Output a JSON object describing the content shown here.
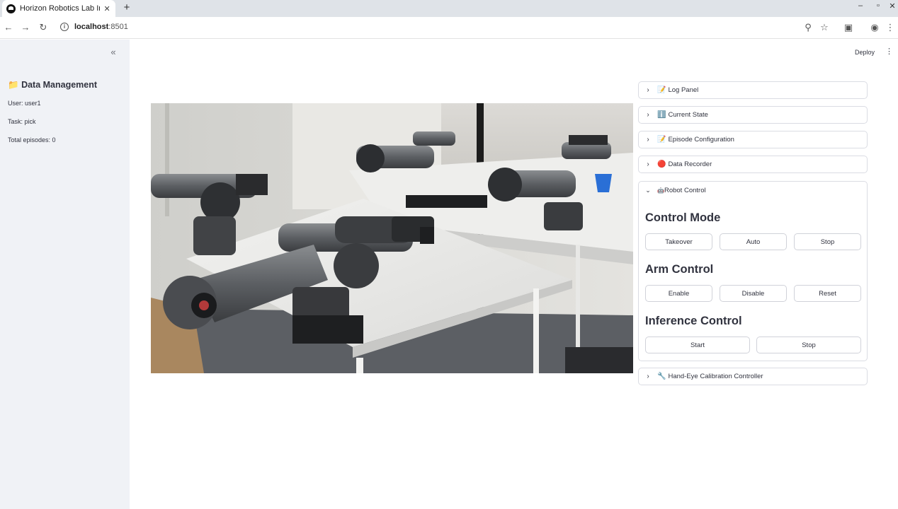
{
  "browser": {
    "tab_title": "Horizon Robotics Lab Inf",
    "tab_close": "✕",
    "new_tab": "+",
    "url_host": "localhost",
    "url_port": ":8501"
  },
  "header": {
    "deploy_label": "Deploy",
    "menu_icon": "⋮"
  },
  "sidebar": {
    "collapse_icon": "«",
    "title_icon": "📁",
    "title": "Data Management",
    "user": "User: user1",
    "task": "Task: pick",
    "episodes": "Total episodes: 0"
  },
  "panels": {
    "log": {
      "icon": "📝",
      "label": "Log Panel"
    },
    "state": {
      "icon": "ℹ️",
      "label": "Current State"
    },
    "episode": {
      "icon": "📝",
      "label": "Episode Configuration"
    },
    "recorder": {
      "icon": "🔴",
      "label": "Data Recorder"
    },
    "robot": {
      "icon": "🤖",
      "label": "Robot Control"
    },
    "calib": {
      "icon": "🔧",
      "label": "Hand-Eye Calibration Controller"
    }
  },
  "robot_control": {
    "control_mode": {
      "heading": "Control Mode",
      "takeover": "Takeover",
      "auto": "Auto",
      "stop": "Stop"
    },
    "arm_control": {
      "heading": "Arm Control",
      "enable": "Enable",
      "disable": "Disable",
      "reset": "Reset"
    },
    "inference_control": {
      "heading": "Inference Control",
      "start": "Start",
      "stop": "Stop"
    }
  },
  "colors": {
    "sidebar_bg": "#f0f2f6",
    "text": "#31333f",
    "border": "#dadce3"
  }
}
